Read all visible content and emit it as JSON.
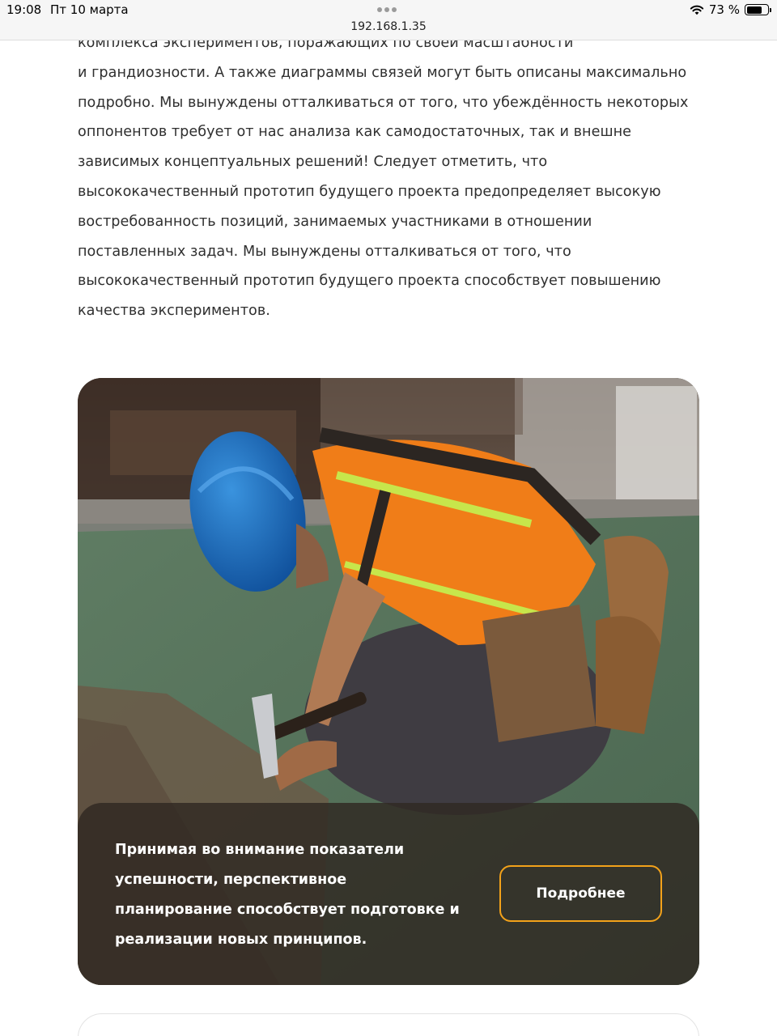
{
  "status_bar": {
    "time": "19:08",
    "date": "Пт 10 марта",
    "url": "192.168.1.35",
    "battery": "73 %",
    "battery_level": 0.73
  },
  "article": {
    "lines": [
      "комплекса экспериментов, поражающих по своей масштабности",
      "и грандиозности. А также диаграммы связей могут быть описаны максимально",
      "подробно. Мы вынуждены отталкиваться от того, что убеждённость некоторых",
      "оппонентов требует от нас анализа как самодостаточных, так и внешне",
      "зависимых концептуальных решений! Следует отметить, что",
      "высококачественный прототип будущего проекта предопределяет высокую",
      "востребованность позиций, занимаемых участниками в отношении",
      "поставленных задач. Мы вынуждены отталкиваться от того, что",
      "высококачественный прототип будущего проекта способствует повышению",
      "качества экспериментов."
    ]
  },
  "card": {
    "lines": [
      "Принимая во внимание показатели",
      "успешности, перспективное",
      "планирование способствует подготовке и",
      "реализации новых принципов."
    ],
    "button_label": "Подробнее",
    "accent_color": "#f3a21a"
  }
}
